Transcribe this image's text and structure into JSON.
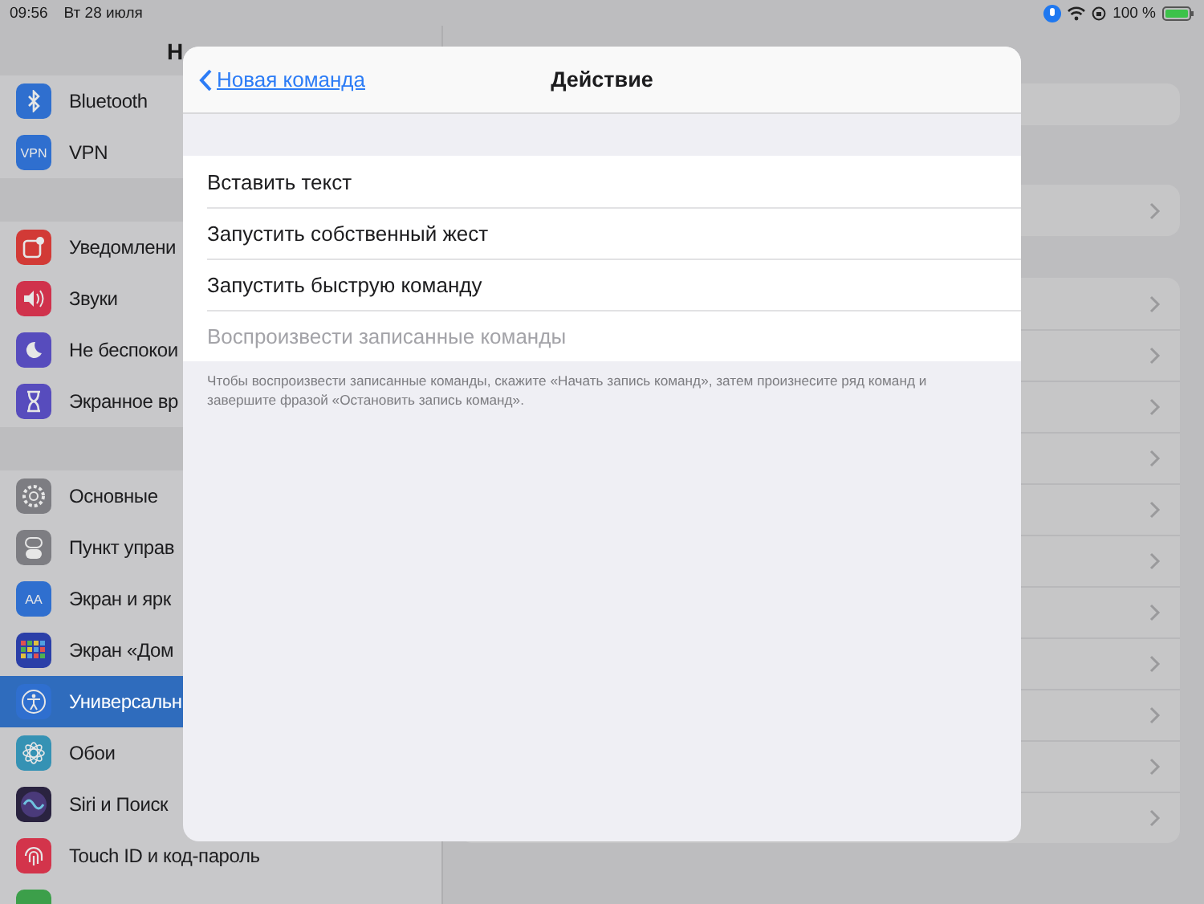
{
  "status_bar": {
    "time": "09:56",
    "date": "Вт 28 июля",
    "battery": "100 %"
  },
  "sidebar": {
    "title": "Н",
    "groups": [
      {
        "items": [
          {
            "label": "Bluetooth",
            "kind": "bluetooth",
            "color": "#2f6fcf",
            "selected": false
          },
          {
            "label": "VPN",
            "kind": "text",
            "icon_text": "VPN",
            "color": "#2f6fcf",
            "selected": false
          }
        ]
      },
      {
        "items": [
          {
            "label": "Уведомлени",
            "kind": "notifications",
            "color": "#d23a36",
            "selected": false
          },
          {
            "label": "Звуки",
            "kind": "sounds",
            "color": "#d0324c",
            "selected": false
          },
          {
            "label": "Не беспокои",
            "kind": "moon",
            "color": "#574cbd",
            "selected": false
          },
          {
            "label": "Экранное вр",
            "kind": "hourglass",
            "color": "#574cbd",
            "selected": false
          }
        ]
      },
      {
        "items": [
          {
            "label": "Основные",
            "kind": "gear",
            "color": "#7d7d82",
            "selected": false
          },
          {
            "label": "Пункт управ",
            "kind": "toggles",
            "color": "#7d7d82",
            "selected": false
          },
          {
            "label": "Экран и ярк",
            "kind": "text",
            "icon_text": "AA",
            "color": "#2f6fcf",
            "selected": false
          },
          {
            "label": "Экран «Дом",
            "kind": "grid",
            "color": "#2b3fa8",
            "selected": false
          },
          {
            "label": "Универсальн",
            "kind": "accessibility",
            "color": "#2f6fcf",
            "selected": true
          },
          {
            "label": "Обои",
            "kind": "flower",
            "color": "#3592b4",
            "selected": false
          },
          {
            "label": "Siri и Поиск",
            "kind": "siri",
            "color": "#2a2340",
            "selected": false
          },
          {
            "label": "Touch ID и код-пароль",
            "kind": "fingerprint",
            "color": "#d3344b",
            "selected": false
          },
          {
            "kind": "blank",
            "color": "#3c9f4a",
            "selected": false
          }
        ]
      }
    ]
  },
  "detail": {
    "groups": [
      {
        "rows": [
          {
            "chevron": true
          }
        ]
      },
      {
        "rows": [
          {
            "chevron": true
          },
          {
            "chevron": true
          },
          {
            "chevron": true
          },
          {
            "chevron": true
          },
          {
            "chevron": true
          },
          {
            "chevron": true
          },
          {
            "chevron": true
          },
          {
            "chevron": true
          },
          {
            "chevron": true
          },
          {
            "chevron": true
          },
          {
            "chevron": true
          }
        ]
      }
    ]
  },
  "modal": {
    "back_link": "Новая команда",
    "title": "Действие",
    "actions": [
      {
        "label": "Вставить текст",
        "disabled": false
      },
      {
        "label": "Запустить собственный жест",
        "disabled": false
      },
      {
        "label": "Запустить быструю команду",
        "disabled": false
      },
      {
        "label": "Воспроизвести записанные команды",
        "disabled": true
      }
    ],
    "footer": "Чтобы воспроизвести записанные команды, скажите «Начать запись команд», затем произнесите ряд команд и завершите фразой «Остановить запись команд»."
  }
}
